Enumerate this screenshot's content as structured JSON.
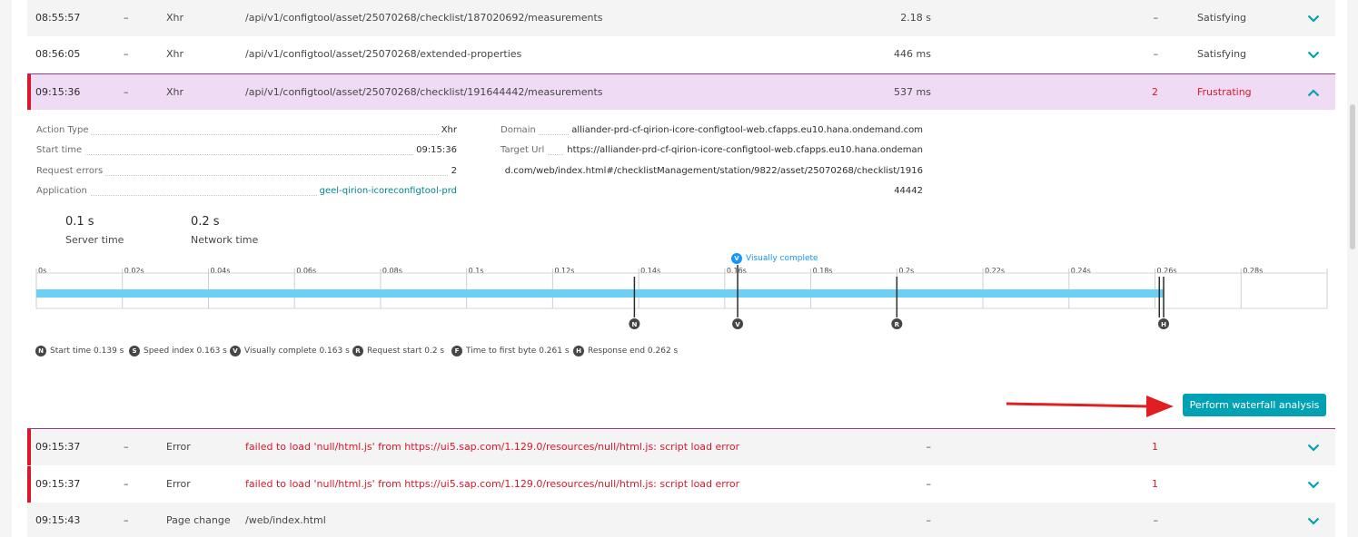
{
  "rows_top": [
    {
      "time": "08:55:57",
      "dash": "–",
      "type": "Xhr",
      "name": "/api/v1/configtool/asset/25070268/checklist/187020692/measurements",
      "duration": "2.18 s",
      "errors": "–",
      "apdex": "Satisfying"
    },
    {
      "time": "08:56:05",
      "dash": "–",
      "type": "Xhr",
      "name": "/api/v1/configtool/asset/25070268/extended-properties",
      "duration": "446 ms",
      "errors": "–",
      "apdex": "Satisfying"
    }
  ],
  "selected_row": {
    "time": "09:15:36",
    "dash": "–",
    "type": "Xhr",
    "name": "/api/v1/configtool/asset/25070268/checklist/191644442/measurements",
    "duration": "537 ms",
    "errors": "2",
    "apdex": "Frustrating"
  },
  "details": {
    "left": [
      {
        "label": "Action Type",
        "value": "Xhr"
      },
      {
        "label": "Start time",
        "value": "09:15:36"
      },
      {
        "label": "Request errors",
        "value": "2"
      },
      {
        "label": "Application",
        "value": "geel-qirion-icoreconfigtool-prd"
      }
    ],
    "domain_label": "Domain",
    "domain_value": "alliander-prd-cf-qirion-icore-configtool-web.cfapps.eu10.hana.ondemand.com",
    "target_label": "Target Url",
    "target_lines": [
      "https://alliander-prd-cf-qirion-icore-configtool-web.cfapps.eu10.hana.ondeman",
      "d.com/web/index.html#/checklistManagement/station/9822/asset/25070268/checklist/1916",
      "44442"
    ],
    "server_time": {
      "value": "0.1 s",
      "label": "Server time"
    },
    "network_time": {
      "value": "0.2 s",
      "label": "Network time"
    }
  },
  "timeline": {
    "ticks": [
      "0s",
      "0.02s",
      "0.04s",
      "0.06s",
      "0.08s",
      "0.1s",
      "0.12s",
      "0.14s",
      "0.16s",
      "0.18s",
      "0.2s",
      "0.22s",
      "0.24s",
      "0.26s",
      "0.28s"
    ],
    "max_seconds": 0.3,
    "bar_end_seconds": 0.262,
    "visually_complete_label": "Visually complete",
    "markers": [
      {
        "letter": "N",
        "seconds": 0.139
      },
      {
        "letter": "V",
        "seconds": 0.163
      },
      {
        "letter": "R",
        "seconds": 0.2
      },
      {
        "letter": "F",
        "seconds": 0.261
      },
      {
        "letter": "H",
        "seconds": 0.262
      }
    ],
    "legend": [
      {
        "letter": "N",
        "text": "Start time 0.139 s"
      },
      {
        "letter": "S",
        "text": "Speed index 0.163 s"
      },
      {
        "letter": "V",
        "text": "Visually complete 0.163 s"
      },
      {
        "letter": "R",
        "text": "Request start 0.2 s"
      },
      {
        "letter": "F",
        "text": "Time to first byte 0.261 s"
      },
      {
        "letter": "H",
        "text": "Response end 0.262 s"
      }
    ],
    "bar_color": "#6cd0f5"
  },
  "waterfall_button": "Perform waterfall analysis",
  "rows_bottom": [
    {
      "time": "09:15:37",
      "dash": "–",
      "type": "Error",
      "name": "failed to load 'null/html.js' from https://ui5.sap.com/1.129.0/resources/null/html.js: script load error",
      "duration": "–",
      "errors": "1",
      "apdex": ""
    },
    {
      "time": "09:15:37",
      "dash": "–",
      "type": "Error",
      "name": "failed to load 'null/html.js' from https://ui5.sap.com/1.129.0/resources/null/html.js: script load error",
      "duration": "–",
      "errors": "1",
      "apdex": ""
    },
    {
      "time": "09:15:43",
      "dash": "–",
      "type": "Page change",
      "name": "/web/index.html",
      "duration": "–",
      "errors": "–",
      "apdex": ""
    }
  ],
  "colors": {
    "accent": "#00a1b2",
    "error": "#dc172a",
    "selected_bg": "#f0dbf5",
    "annotation_arrow": "#e02020"
  }
}
